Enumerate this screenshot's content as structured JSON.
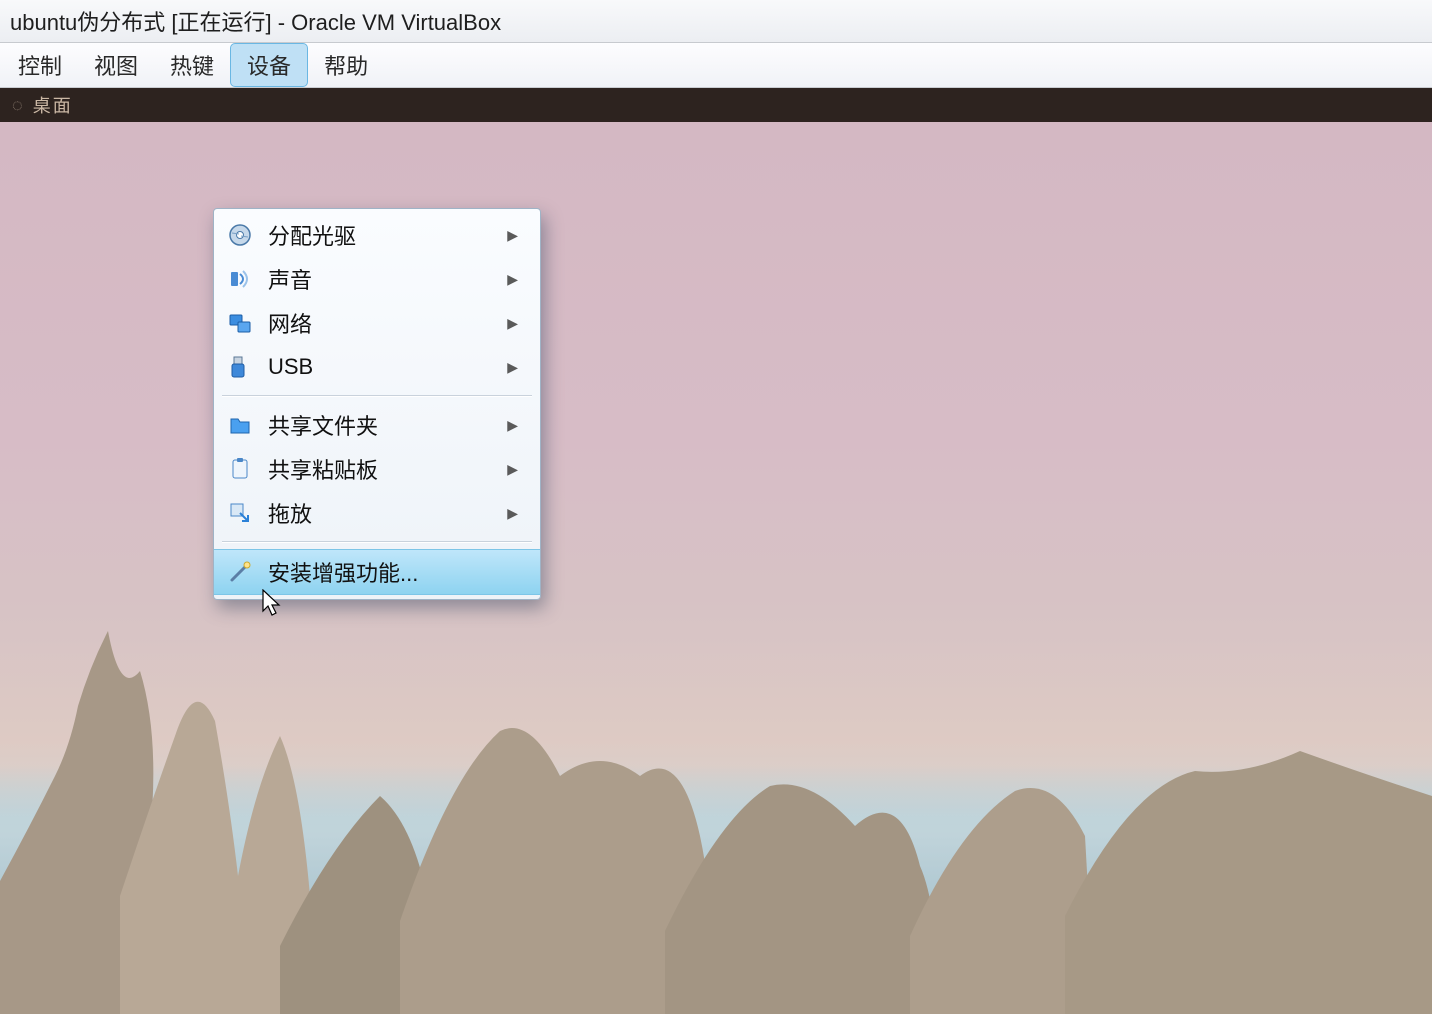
{
  "window": {
    "title": "ubuntu伪分布式 [正在运行] - Oracle VM VirtualBox"
  },
  "menubar": {
    "items": [
      {
        "label": "控制"
      },
      {
        "label": "视图"
      },
      {
        "label": "热键"
      },
      {
        "label": "设备"
      },
      {
        "label": "帮助"
      }
    ],
    "active_index": 3
  },
  "guestbar": {
    "label": "桌面"
  },
  "devices_menu": {
    "groups": [
      [
        {
          "icon": "disc",
          "label": "分配光驱",
          "submenu": true
        },
        {
          "icon": "audio",
          "label": "声音",
          "submenu": true
        },
        {
          "icon": "network",
          "label": "网络",
          "submenu": true
        },
        {
          "icon": "usb",
          "label": "USB",
          "submenu": true
        }
      ],
      [
        {
          "icon": "folder",
          "label": "共享文件夹",
          "submenu": true
        },
        {
          "icon": "clipboard",
          "label": "共享粘贴板",
          "submenu": true
        },
        {
          "icon": "drag",
          "label": "拖放",
          "submenu": true
        }
      ],
      [
        {
          "icon": "wand",
          "label": "安装增强功能...",
          "submenu": false,
          "highlight": true
        }
      ]
    ]
  }
}
